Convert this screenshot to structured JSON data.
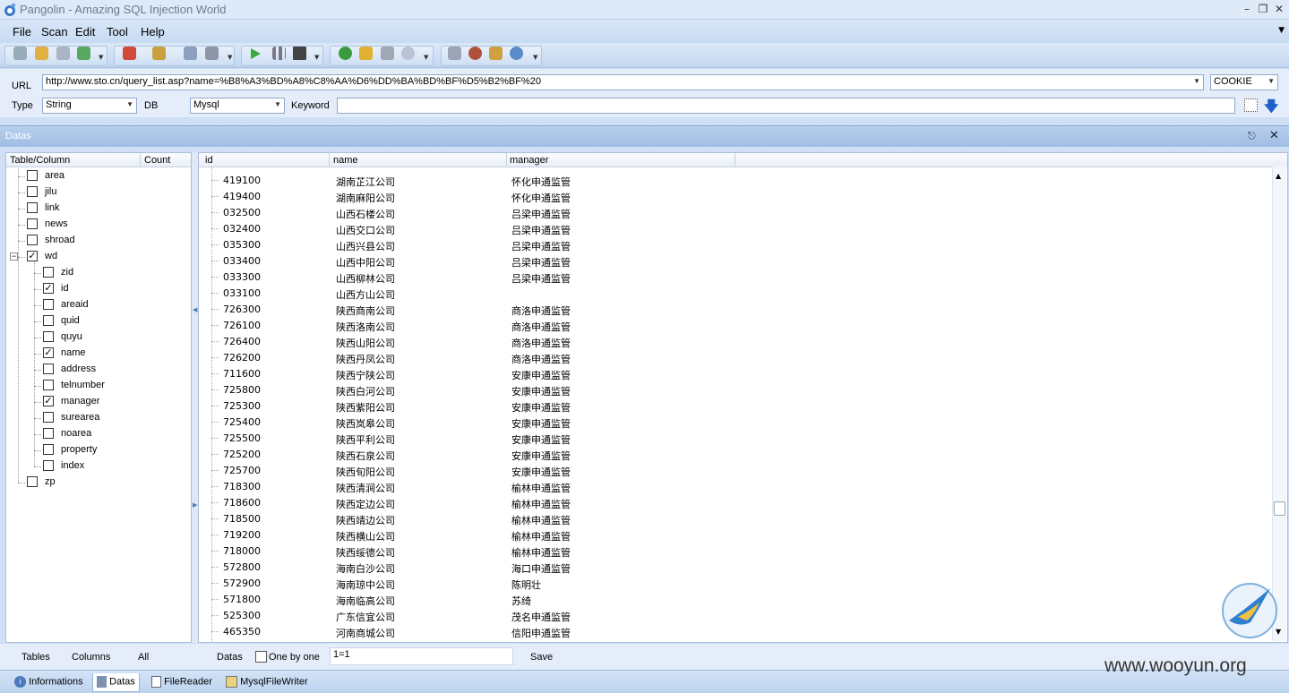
{
  "window": {
    "title": "Pangolin - Amazing SQL Injection World"
  },
  "menu": [
    "File",
    "Scan",
    "Edit",
    "Tool",
    "Help"
  ],
  "url_panel": {
    "url_label": "URL",
    "url_value": "http://www.sto.cn/query_list.asp?name=%B8%A3%BD%A8%C8%AA%D6%DD%BA%BD%BF%D5%B2%BF%20",
    "cookie_value": "COOKIE",
    "type_label": "Type",
    "type_value": "String",
    "db_label": "DB",
    "db_value": "Mysql",
    "keyword_label": "Keyword",
    "keyword_value": ""
  },
  "datas_panel": {
    "title": "Datas"
  },
  "tree": {
    "col_table": "Table/Column",
    "col_count": "Count",
    "items": [
      {
        "label": "area",
        "level": 0,
        "checked": false
      },
      {
        "label": "jilu",
        "level": 0,
        "checked": false
      },
      {
        "label": "link",
        "level": 0,
        "checked": false
      },
      {
        "label": "news",
        "level": 0,
        "checked": false
      },
      {
        "label": "shroad",
        "level": 0,
        "checked": false
      },
      {
        "label": "wd",
        "level": 0,
        "checked": true,
        "expanded": true
      },
      {
        "label": "zid",
        "level": 1,
        "checked": false
      },
      {
        "label": "id",
        "level": 1,
        "checked": true
      },
      {
        "label": "areaid",
        "level": 1,
        "checked": false
      },
      {
        "label": "quid",
        "level": 1,
        "checked": false
      },
      {
        "label": "quyu",
        "level": 1,
        "checked": false
      },
      {
        "label": "name",
        "level": 1,
        "checked": true
      },
      {
        "label": "address",
        "level": 1,
        "checked": false
      },
      {
        "label": "telnumber",
        "level": 1,
        "checked": false
      },
      {
        "label": "manager",
        "level": 1,
        "checked": true
      },
      {
        "label": "surearea",
        "level": 1,
        "checked": false
      },
      {
        "label": "noarea",
        "level": 1,
        "checked": false
      },
      {
        "label": "property",
        "level": 1,
        "checked": false
      },
      {
        "label": "index",
        "level": 1,
        "checked": false
      },
      {
        "label": "zp",
        "level": 0,
        "checked": false
      }
    ]
  },
  "grid": {
    "columns": [
      "id",
      "name",
      "manager"
    ],
    "rows": [
      [
        "419100",
        "湖南芷江公司",
        "怀化申通监管"
      ],
      [
        "419400",
        "湖南麻阳公司",
        "怀化申通监管"
      ],
      [
        "032500",
        "山西石楼公司",
        "吕梁申通监管"
      ],
      [
        "032400",
        "山西交口公司",
        "吕梁申通监管"
      ],
      [
        "035300",
        "山西兴县公司",
        "吕梁申通监管"
      ],
      [
        "033400",
        "山西中阳公司",
        "吕梁申通监管"
      ],
      [
        "033300",
        "山西柳林公司",
        "吕梁申通监管"
      ],
      [
        "033100",
        "山西方山公司",
        ""
      ],
      [
        "726300",
        "陕西商南公司",
        "商洛申通监管"
      ],
      [
        "726100",
        "陕西洛南公司",
        "商洛申通监管"
      ],
      [
        "726400",
        "陕西山阳公司",
        "商洛申通监管"
      ],
      [
        "726200",
        "陕西丹凤公司",
        "商洛申通监管"
      ],
      [
        "711600",
        "陕西宁陕公司",
        "安康申通监管"
      ],
      [
        "725800",
        "陕西白河公司",
        "安康申通监管"
      ],
      [
        "725300",
        "陕西紫阳公司",
        "安康申通监管"
      ],
      [
        "725400",
        "陕西岚皋公司",
        "安康申通监管"
      ],
      [
        "725500",
        "陕西平利公司",
        "安康申通监管"
      ],
      [
        "725200",
        "陕西石泉公司",
        "安康申通监管"
      ],
      [
        "725700",
        "陕西旬阳公司",
        "安康申通监管"
      ],
      [
        "718300",
        "陕西清涧公司",
        "榆林申通监管"
      ],
      [
        "718600",
        "陕西定边公司",
        "榆林申通监管"
      ],
      [
        "718500",
        "陕西靖边公司",
        "榆林申通监管"
      ],
      [
        "719200",
        "陕西横山公司",
        "榆林申通监管"
      ],
      [
        "718000",
        "陕西绥德公司",
        "榆林申通监管"
      ],
      [
        "572800",
        "海南白沙公司",
        "海口申通监管"
      ],
      [
        "572900",
        "海南琼中公司",
        "陈明壮"
      ],
      [
        "571800",
        "海南临高公司",
        "苏绮"
      ],
      [
        "525300",
        "广东信宜公司",
        "茂名申通监管"
      ],
      [
        "465350",
        "河南商城公司",
        "信阳申通监管"
      ]
    ]
  },
  "bottom": {
    "tables_tab": "Tables",
    "columns_tab": "Columns",
    "all_tab": "All",
    "datas_label": "Datas",
    "one_by_one": "One by one",
    "condition_value": "1=1",
    "save_label": "Save"
  },
  "tabs": [
    "Informations",
    "Datas",
    "FileReader",
    "MysqlFileWriter"
  ],
  "watermark": "www.wooyun.org"
}
